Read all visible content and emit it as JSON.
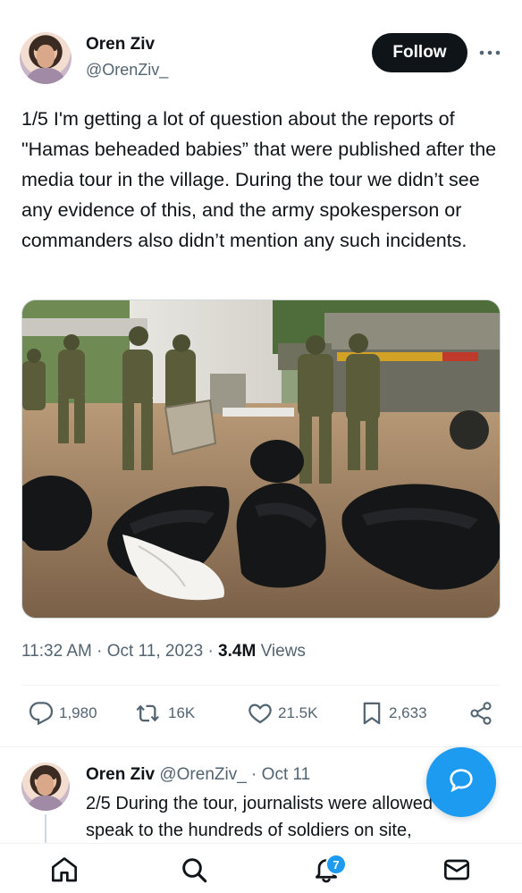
{
  "author": {
    "name": "Oren Ziv",
    "handle": "@OrenZiv_"
  },
  "follow_label": "Follow",
  "tweet": {
    "text": "1/5 I'm getting a lot of question about the reports of \"Hamas beheaded babies” that were published after the media tour in the village. During the tour we didn’t see any evidence of this, and the army spokesperson or commanders also didn’t mention any such incidents.",
    "time": "11:32 AM",
    "date": "Oct 11, 2023",
    "views_count": "3.4M",
    "views_label": "Views"
  },
  "actions": {
    "replies": "1,980",
    "reposts": "16K",
    "likes": "21.5K",
    "bookmarks": "2,633"
  },
  "reply": {
    "name": "Oren Ziv",
    "meta": "@OrenZiv_ · Oct 11",
    "line1": "2/5 During the tour, journalists were allowed to",
    "line2": "speak to the hundreds of soldiers on site,"
  },
  "notifications_badge": "7",
  "colors": {
    "accent": "#1d9bf0",
    "text_primary": "#0f1419",
    "text_secondary": "#536471",
    "follow_button_bg": "#0f1419"
  },
  "icons": {
    "more": "more-icon",
    "reply": "reply-icon",
    "repost": "repost-icon",
    "like": "heart-icon",
    "bookmark": "bookmark-icon",
    "share": "share-icon",
    "compose": "message-bubble-icon",
    "home": "home-icon",
    "search": "search-icon",
    "notifications": "bell-icon",
    "messages": "mail-icon"
  }
}
